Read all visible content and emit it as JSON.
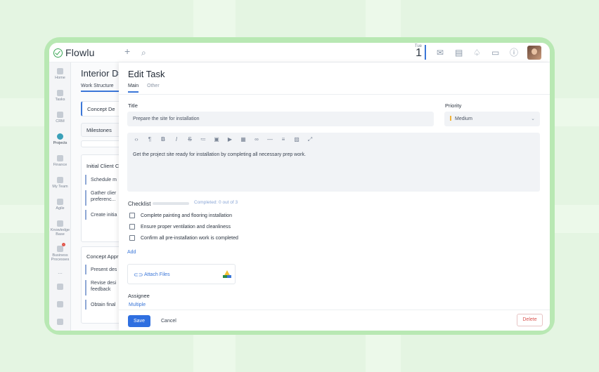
{
  "app": {
    "name": "Flowlu"
  },
  "topbar": {
    "date_weekday": "Tue",
    "date_day": "1"
  },
  "sidebar": {
    "items": [
      {
        "label": "Home"
      },
      {
        "label": "Tasks"
      },
      {
        "label": "CRM"
      },
      {
        "label": "Projects"
      },
      {
        "label": "Finance"
      },
      {
        "label": "My Team"
      },
      {
        "label": "Agile"
      },
      {
        "label": "Knowledge Base"
      },
      {
        "label": "Business Processes"
      }
    ],
    "more": "..."
  },
  "project": {
    "title": "Interior D",
    "tab": "Work Structure",
    "phases": [
      {
        "label": "Concept De"
      },
      {
        "label": "Milestones"
      },
      {
        "label": "Initial Client C"
      },
      {
        "label": "Concept Appr"
      }
    ],
    "tasks_a": [
      "Schedule m",
      "Gather clier preferenc...",
      "Create initia"
    ],
    "tasks_b": [
      "Present des",
      "Revise desi feedback",
      "Obtain final"
    ]
  },
  "edit_task": {
    "title": "Edit Task",
    "tabs": [
      "Main",
      "Other"
    ],
    "title_label": "Title",
    "title_value": "Prepare the site for installation",
    "priority_label": "Priority",
    "priority_value": "Medium",
    "description": "Get the project site ready for installation by completing all necessary prep work.",
    "checklist_label": "Checklist",
    "checklist_progress": 0,
    "checklist_status": "Completed: 0 out of 3",
    "checklist_items": [
      "Complete painting and flooring installation",
      "Ensure proper ventilation and cleanliness",
      "Confirm all pre-installation work is completed"
    ],
    "add_label": "Add",
    "attach_label": "Attach Files",
    "assignee_label": "Assignee",
    "assignee_value": "Multiple",
    "save_label": "Save",
    "cancel_label": "Cancel",
    "delete_label": "Delete"
  },
  "colors": {
    "accent": "#2f6fe0",
    "brand": "#3aa655",
    "background": "#e4f5e2"
  }
}
